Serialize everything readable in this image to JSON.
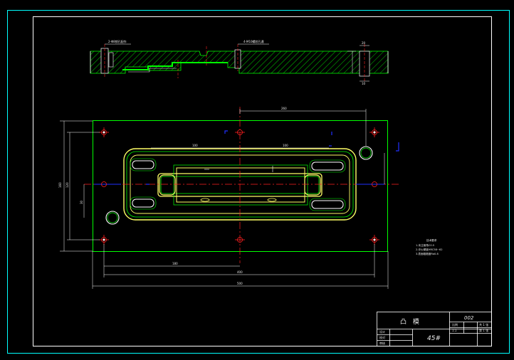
{
  "title_block": {
    "name": "凸 模",
    "drawing_no": "002",
    "material": "45#",
    "scale_label": "比例",
    "scale_value": "1:1",
    "row_labels": [
      "设计",
      "校对",
      "审核"
    ],
    "sheet_cells": [
      "共 1 张",
      "第 1 张"
    ]
  },
  "notes": {
    "heading": "技术要求",
    "items": [
      "1.未注倒角C0.5",
      "2.淬火硬度HRC58~62",
      "3.表面粗糙度Ra0.8"
    ]
  },
  "dimensions": {
    "plan_top": "260",
    "inner_top_left": "100",
    "inner_top_right": "100",
    "left_outer": "160",
    "left_mid": "120",
    "left_small": "30",
    "bottom_inner": "180",
    "bottom_mid": "400",
    "bottom_outer": "500",
    "section_width": "20",
    "section_depth": "10"
  },
  "callouts": {
    "section_left": "2-Φ8销孔配作",
    "section_right": "4-M10螺纹孔通"
  },
  "colors": {
    "background": "#000000",
    "frame": "#00ffff",
    "geometry": "#00ff00",
    "centerline": "#ff2020",
    "dimension": "#ffffff",
    "outline": "#ffff66",
    "marker": "#2030ff"
  }
}
